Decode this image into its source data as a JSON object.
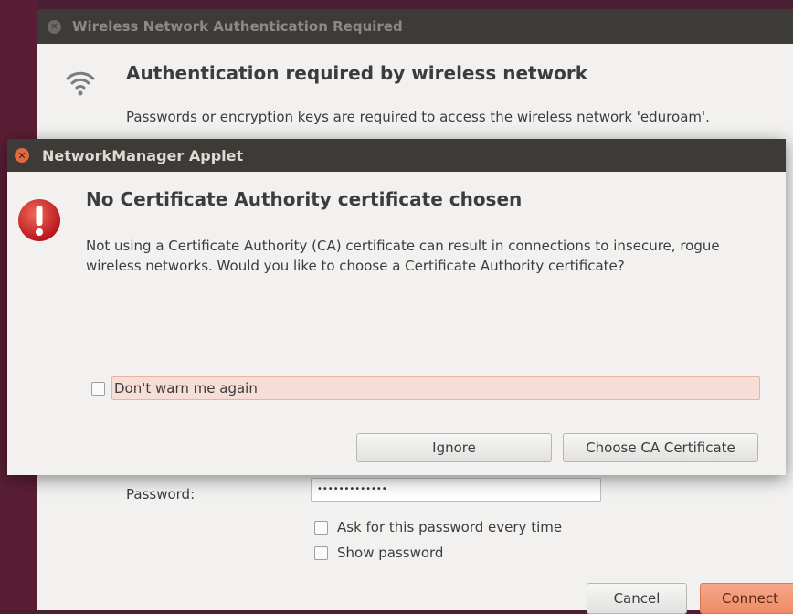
{
  "back_window": {
    "title": "Wireless Network Authentication Required",
    "heading": "Authentication required by wireless network",
    "description": "Passwords or encryption keys are required to access the wireless network 'eduroam'.",
    "password_label": "Password:",
    "password_value": "•••••••••••••",
    "ask_every_time_label": "Ask for this password every time",
    "show_password_label": "Show password",
    "cancel_label": "Cancel",
    "connect_label": "Connect"
  },
  "dialog": {
    "title": "NetworkManager Applet",
    "heading": "No Certificate Authority certificate chosen",
    "body": "Not using a Certificate Authority (CA) certificate can result in connections to insecure, rogue wireless networks.  Would you like to choose a Certificate Authority certificate?",
    "dont_warn_label": "Don't warn me again",
    "ignore_label": "Ignore",
    "choose_ca_label": "Choose CA Certificate"
  },
  "icons": {
    "wifi": "wifi-icon",
    "error": "error-icon",
    "close": "close-icon"
  },
  "colors": {
    "titlebar": "#3c3b37",
    "close_button": "#e06b41",
    "connect_button": "#ee8a63",
    "warning_highlight": "#f6ddd6"
  }
}
